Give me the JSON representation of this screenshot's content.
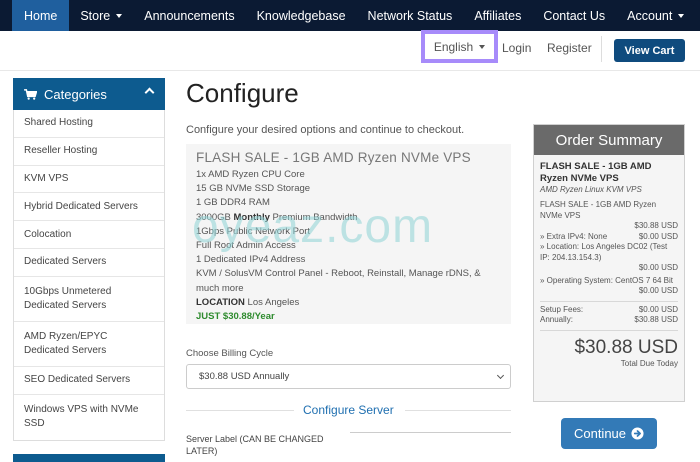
{
  "nav": {
    "home": "Home",
    "store": "Store",
    "announcements": "Announcements",
    "knowledgebase": "Knowledgebase",
    "network_status": "Network Status",
    "affiliates": "Affiliates",
    "contact": "Contact Us",
    "account": "Account"
  },
  "header": {
    "language": "English",
    "login": "Login",
    "register": "Register",
    "view_cart": "View Cart"
  },
  "sidebar": {
    "title": "Categories",
    "items": [
      {
        "label": "Shared Hosting",
        "h": 1
      },
      {
        "label": "Reseller Hosting",
        "h": 1
      },
      {
        "label": "KVM VPS",
        "h": 1
      },
      {
        "label": "Hybrid Dedicated Servers",
        "h": 1
      },
      {
        "label": "Colocation",
        "h": 1
      },
      {
        "label": "Dedicated Servers",
        "h": 1
      },
      {
        "label": "10Gbps Unmetered Dedicated Servers",
        "h": 2
      },
      {
        "label": "AMD Ryzen/EPYC Dedicated Servers",
        "h": 2
      },
      {
        "label": "SEO Dedicated Servers",
        "h": 1
      },
      {
        "label": "Windows VPS with NVMe SSD",
        "h": 2
      }
    ]
  },
  "main": {
    "title": "Configure",
    "subtitle": "Configure your desired options and continue to checkout.",
    "product": {
      "name": "FLASH SALE - 1GB AMD Ryzen NVMe VPS",
      "features": [
        "1x AMD Ryzen CPU Core",
        "15 GB NVMe SSD Storage",
        "1 GB DDR4 RAM"
      ],
      "bandwidth_pre": "3000GB ",
      "bandwidth_bold": "Monthly",
      "bandwidth_post": " Premium Bandwidth",
      "features2": [
        "1Gbps Public Network Port",
        "Full Root Admin Access",
        "1 Dedicated IPv4 Address",
        "KVM / SolusVM Control Panel - Reboot, Reinstall, Manage rDNS, & much more"
      ],
      "location_label": "LOCATION",
      "location_value": " Los Angeles",
      "price": "JUST $30.88/Year"
    },
    "billing_label": "Choose Billing Cycle",
    "billing_value": "$30.88 USD Annually",
    "section_title": "Configure Server",
    "server_label": "Server Label (CAN BE CHANGED LATER)"
  },
  "summary": {
    "title": "Order Summary",
    "product": "FLASH SALE - 1GB AMD Ryzen NVMe VPS",
    "group": "AMD Ryzen Linux KVM VPS",
    "line_name": "FLASH SALE - 1GB AMD Ryzen NVMe VPS",
    "line_price": "$30.88 USD",
    "extra_ipv4_label": "» Extra IPv4: None",
    "extra_ipv4_price": "$0.00 USD",
    "location_label": "» Location: Los Angeles DC02 (Test IP: 204.13.154.3)",
    "location_price": "$0.00 USD",
    "os_label": "» Operating System: CentOS 7 64 Bit",
    "os_price": "$0.00 USD",
    "setup_label": "Setup Fees:",
    "setup_price": "$0.00 USD",
    "annually_label": "Annually:",
    "annually_price": "$30.88 USD",
    "total": "$30.88 USD",
    "total_due": "Total Due Today"
  },
  "continue_label": "Continue",
  "watermark": "oyeaz.com",
  "colors": {
    "nav_bg": "#0b1a33",
    "nav_active": "#1f5f9e",
    "sidebar_head": "#0d5b8f",
    "highlight_border": "#a78bfa",
    "price_green": "#2e8b2e",
    "continue_btn": "#337ab7"
  }
}
